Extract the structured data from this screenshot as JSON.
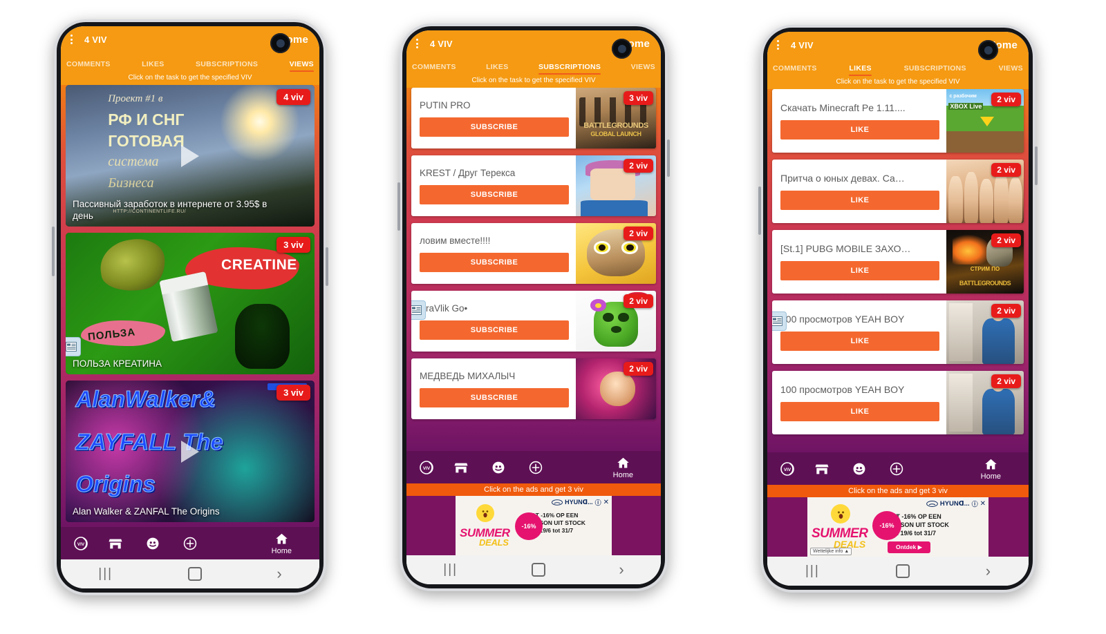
{
  "app": {
    "title": "4 VIV",
    "home_label": "Home",
    "hint": "Click on the task to get the specified VIV",
    "ad_hint": "Click on the ads and get 3 viv",
    "menu_icon": "kebab-menu-icon",
    "colors": {
      "header": "#f59a12",
      "accent_button": "#f4682f",
      "badge": "#e81b1b",
      "bottom_nav": "#5e1055",
      "ad_hint_bar": "#f05a0c",
      "tab_indicator": "#f05a1e"
    },
    "tabs": [
      "COMMENTS",
      "LIKES",
      "SUBSCRIPTIONS",
      "VIEWS"
    ],
    "bottom_nav": [
      {
        "icon": "viv-coin-icon",
        "label": ""
      },
      {
        "icon": "store-icon",
        "label": ""
      },
      {
        "icon": "face-smiley-icon",
        "label": ""
      },
      {
        "icon": "plus-circle-icon",
        "label": ""
      },
      {
        "icon": "home-icon",
        "label": "Home"
      }
    ],
    "system_nav": [
      "recents-icon",
      "home-circle-icon",
      "back-chevron-icon"
    ]
  },
  "ad": {
    "brand": "HYUNDAI",
    "brand_short": "HYUNᗡ...",
    "headline_1": "TOT -16% OP EEN",
    "headline_2": "TUCSON UIT STOCK",
    "headline_3": "Van 19/6 tot 31/7",
    "cta": "Ontdek",
    "legal": "Wettelijke info",
    "burst": "-16%",
    "summer": "SUMMER",
    "deals": "DEALS",
    "info_icon": "ad-info-icon",
    "close_icon": "ad-close-icon"
  },
  "phones": [
    {
      "id": "phone-views",
      "active_tab": "VIEWS",
      "has_ad": false,
      "cards": [
        {
          "type": "view",
          "title": "Пассивный заработок в интернете от 3.95$ в день",
          "viv": "4 viv",
          "art": "a-forest",
          "art_text": {
            "l1": "Проект #1 в",
            "l2": "РФ И СНГ",
            "l3": "ГОТОВАЯ",
            "l4": "система",
            "l5": "Бизнеса",
            "url": "HTTP://CONTINENTLIFE.RU/"
          },
          "broken_image": false
        },
        {
          "type": "view",
          "title": "ПОЛЬЗА КРЕАТИНА",
          "viv": "3 viv",
          "art": "a-creatine",
          "art_text": {
            "cword": "CREATINE",
            "pword": "ПОЛЬЗА"
          },
          "broken_image": true
        },
        {
          "type": "view",
          "title": "Alan Walker & ZANFAL The Origins",
          "viv": "3 viv",
          "art": "a-alan",
          "art_text": {
            "l1": "AlanWalker&",
            "l2": "ZAYFALL The",
            "l3": "Origins"
          },
          "broken_image": false
        }
      ]
    },
    {
      "id": "phone-subscriptions",
      "active_tab": "SUBSCRIPTIONS",
      "has_ad": true,
      "action_label": "SUBSCRIBE",
      "cards": [
        {
          "type": "task",
          "name": "PUTIN PRO",
          "viv": "3 viv",
          "art": "a-pubg",
          "broken_image": false
        },
        {
          "type": "task",
          "name": "KREST / Друг Терекса",
          "viv": "2 viv",
          "art": "a-krest",
          "broken_image": false
        },
        {
          "type": "task",
          "name": "ловим вместе!!!!",
          "viv": "2 viv",
          "art": "a-owl",
          "broken_image": false
        },
        {
          "type": "task",
          "name": "BraVlik Go•",
          "viv": "2 viv",
          "art": "a-spike",
          "broken_image": true
        },
        {
          "type": "task",
          "name": "МЕДВЕДЬ МИХАЛЫЧ",
          "viv": "2 viv",
          "art": "a-bear",
          "broken_image": false
        }
      ]
    },
    {
      "id": "phone-likes",
      "active_tab": "LIKES",
      "has_ad": true,
      "action_label": "LIKE",
      "cards": [
        {
          "type": "task",
          "name": "Скачать Minecraft Pe 1.11....",
          "viv": "2 viv",
          "art": "a-mc",
          "broken_image": false
        },
        {
          "type": "task",
          "name": "Притча о юных девах. Са…",
          "viv": "2 viv",
          "art": "a-girls",
          "broken_image": false
        },
        {
          "type": "task",
          "name": "[St.1] PUBG MOBILE ЗАХО…",
          "viv": "2 viv",
          "art": "a-stream",
          "broken_image": false
        },
        {
          "type": "task",
          "name": "100 просмотров YEAH BOY",
          "viv": "2 viv",
          "art": "a-room",
          "broken_image": true
        },
        {
          "type": "task",
          "name": "100 просмотров YEAH BOY",
          "viv": "2 viv",
          "art": "a-room",
          "broken_image": false
        }
      ]
    }
  ]
}
